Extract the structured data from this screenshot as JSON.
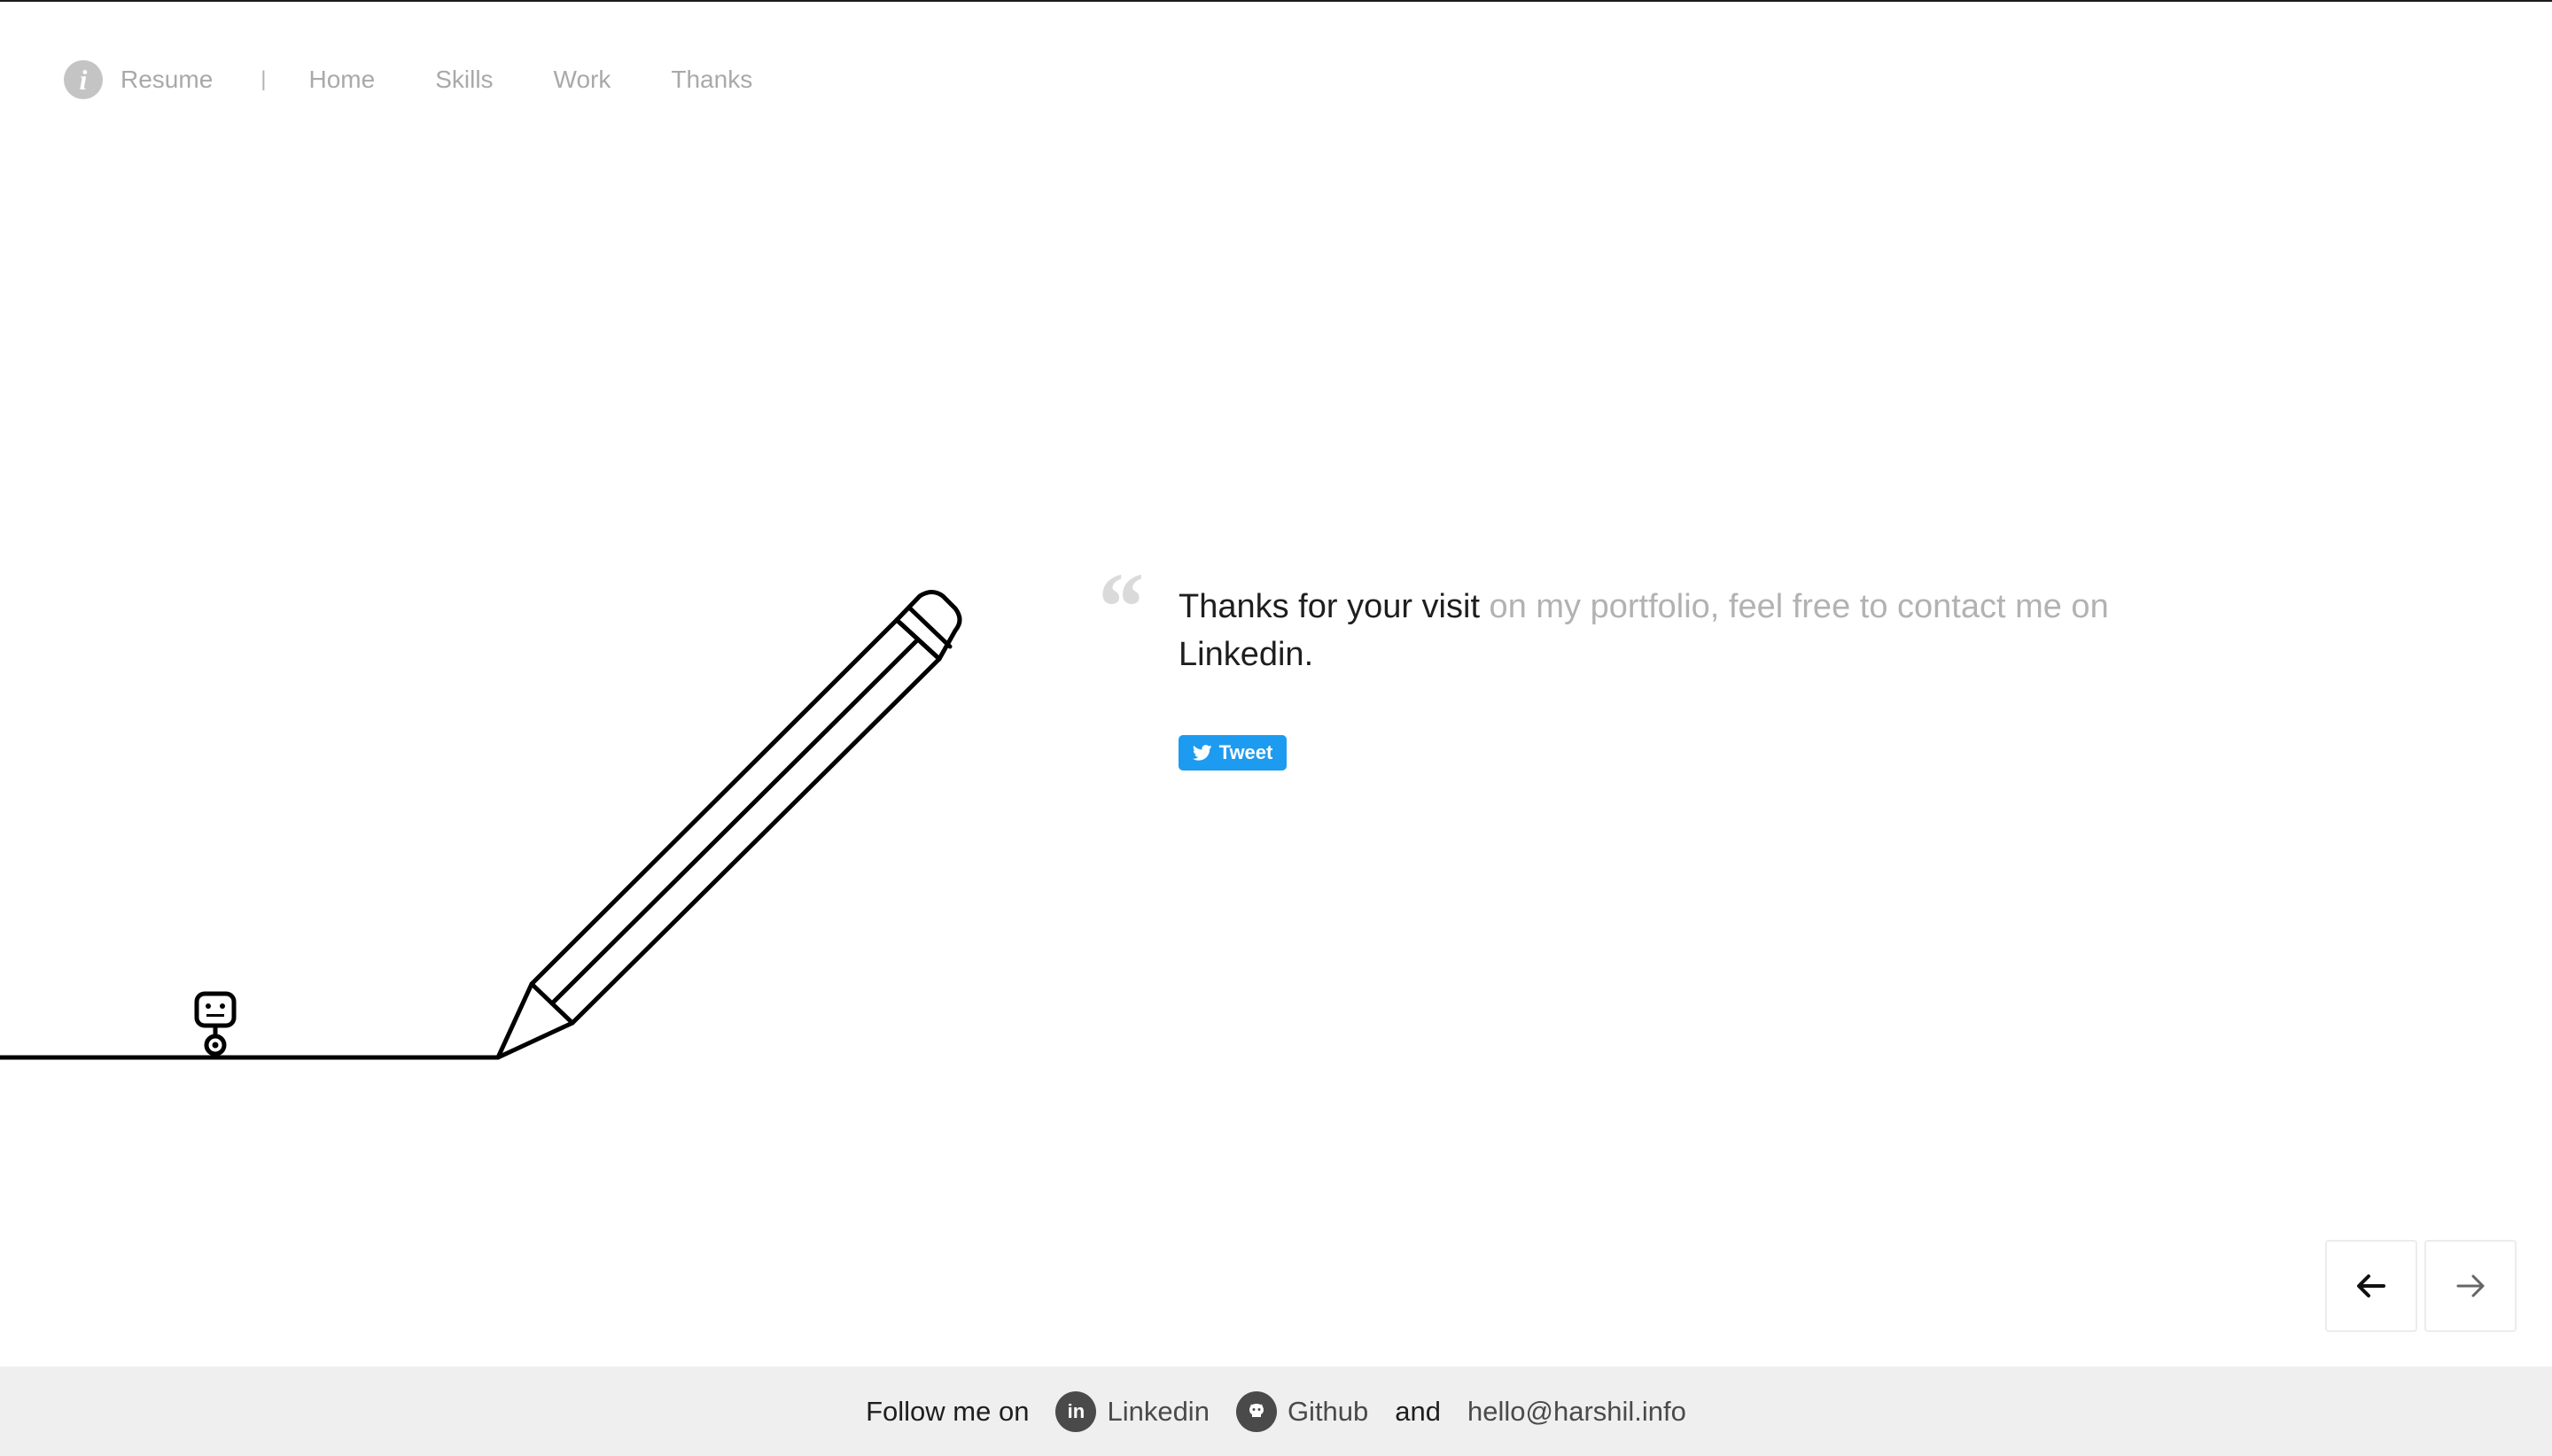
{
  "nav": {
    "info_icon_glyph": "i",
    "resume_label": "Resume",
    "separator": "|",
    "items": [
      {
        "label": "Home"
      },
      {
        "label": "Skills"
      },
      {
        "label": "Work"
      },
      {
        "label": "Thanks"
      }
    ]
  },
  "quote": {
    "mark": "“",
    "part1": "Thanks for your visit",
    "part2": " on my portfolio, feel free to contact me on ",
    "link": "Linkedin",
    "end": "."
  },
  "tweet": {
    "label": "Tweet",
    "color": "#1d9bf0"
  },
  "pager": {
    "prev_icon": "arrow-left-icon",
    "next_icon": "arrow-right-icon"
  },
  "footer": {
    "follow": "Follow me on",
    "linkedin_badge": "in",
    "linkedin": "Linkedin",
    "github_icon": "github-icon",
    "github": "Github",
    "and": "and",
    "email": "hello@harshil.info"
  },
  "colors": {
    "nav_text": "#a9a9a9",
    "muted_text": "#b2b2b2",
    "dark_text": "#1e1e1e",
    "footer_bg": "#efefef"
  }
}
